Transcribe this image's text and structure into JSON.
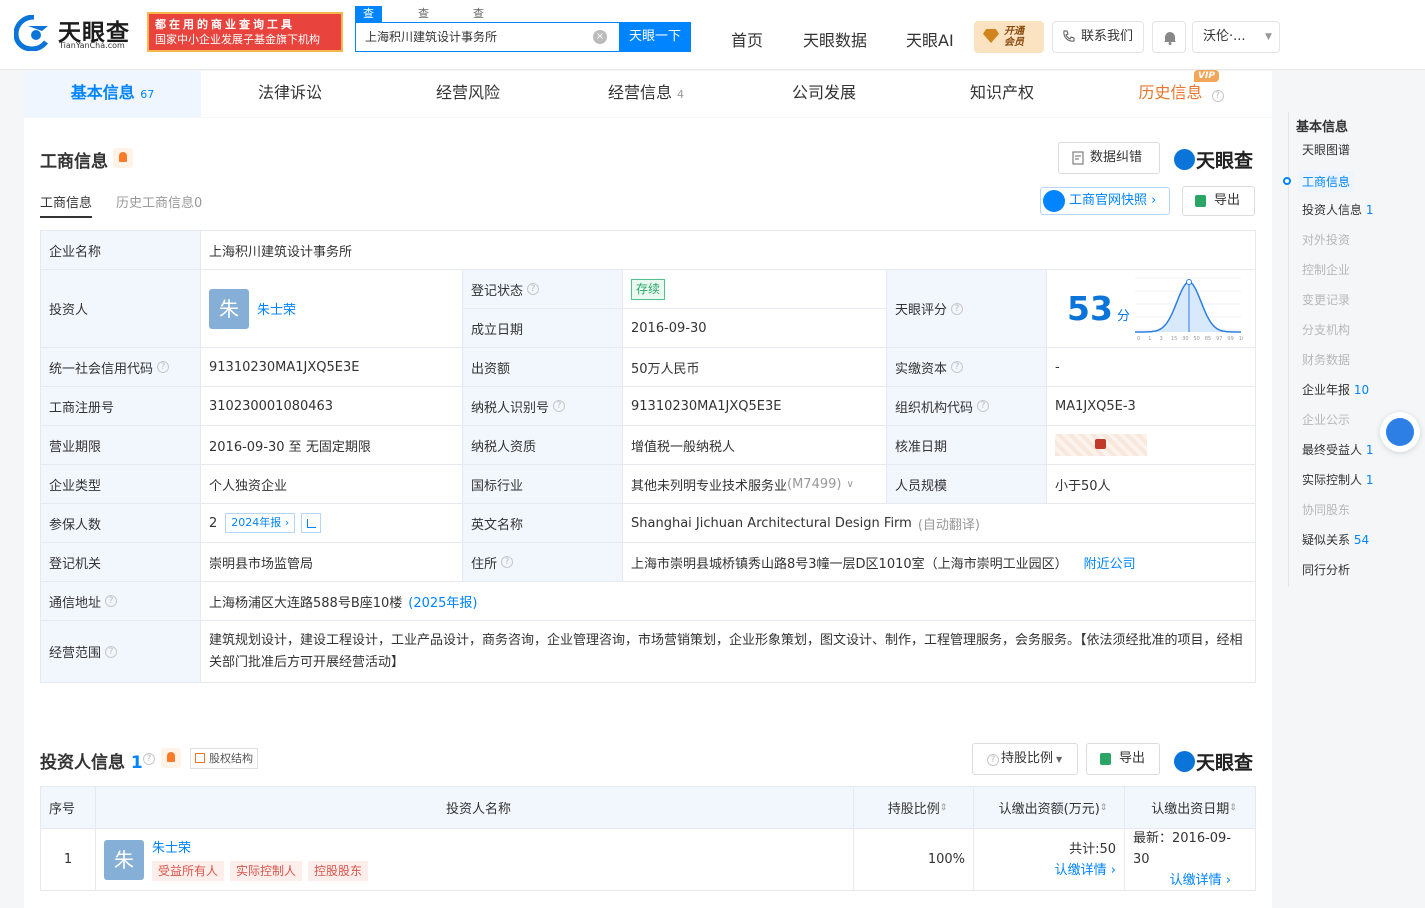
{
  "header": {
    "logo_cn": "天眼查",
    "logo_en": "TianYanCha.com",
    "promo_line1": "都在用的商业查询工具",
    "promo_line2": "国家中小企业发展子基金旗下机构",
    "search_tabs": [
      "查公司",
      "查老板",
      "查关系"
    ],
    "search_value": "上海积川建筑设计事务所",
    "search_button": "天眼一下",
    "nav": [
      "首页",
      "天眼数据",
      "天眼AI"
    ],
    "vip_line1": "开通",
    "vip_line2": "会员",
    "contact": "联系我们",
    "user": "沃伦·..."
  },
  "tabs": [
    {
      "label": "基本信息",
      "count": "67"
    },
    {
      "label": "法律诉讼",
      "count": ""
    },
    {
      "label": "经营风险",
      "count": ""
    },
    {
      "label": "经营信息",
      "count": "4"
    },
    {
      "label": "公司发展",
      "count": ""
    },
    {
      "label": "知识产权",
      "count": ""
    },
    {
      "label": "历史信息",
      "count": "",
      "vip": "VIP"
    }
  ],
  "biz": {
    "title": "工商信息",
    "correct_btn": "数据纠错",
    "brand": "天眼查",
    "sub_tabs": [
      "工商信息",
      "历史工商信息0"
    ],
    "snapshot_btn": "工商官网快照",
    "export_btn": "导出",
    "labels": {
      "name": "企业名称",
      "investor": "投资人",
      "reg_status": "登记状态",
      "found_date": "成立日期",
      "score": "天眼评分",
      "credit_code": "统一社会信用代码",
      "capital": "出资额",
      "paid_capital": "实缴资本",
      "reg_no": "工商注册号",
      "tax_id": "纳税人识别号",
      "org_code": "组织机构代码",
      "period": "营业期限",
      "tax_quality": "纳税人资质",
      "approve_date": "核准日期",
      "type": "企业类型",
      "industry": "国标行业",
      "staff": "人员规模",
      "insured": "参保人数",
      "en_name": "英文名称",
      "authority": "登记机关",
      "address": "住所",
      "mail_addr": "通信地址",
      "scope": "经营范围"
    },
    "values": {
      "name": "上海积川建筑设计事务所",
      "investor_avatar": "朱",
      "investor": "朱士荣",
      "reg_status": "存续",
      "found_date": "2016-09-30",
      "score": "53",
      "score_unit": "分",
      "credit_code": "91310230MA1JXQ5E3E",
      "capital": "50万人民币",
      "paid_capital": "-",
      "reg_no": "310230001080463",
      "tax_id": "91310230MA1JXQ5E3E",
      "org_code": "MA1JXQ5E-3",
      "period": "2016-09-30 至 无固定期限",
      "tax_quality": "增值税一般纳税人",
      "type": "个人独资企业",
      "industry": "其他未列明专业技术服务业",
      "industry_code": "(M7499)",
      "staff": "小于50人",
      "insured": "2",
      "insured_report": "2024年报",
      "en_name": "Shanghai Jichuan Architectural Design Firm",
      "en_note": "(自动翻译)",
      "authority": "崇明县市场监管局",
      "address": "上海市崇明县城桥镇秀山路8号3幢一层D区1010室（上海市崇明工业园区）",
      "nearby": "附近公司",
      "mail_addr": "上海杨浦区大连路588号B座10楼",
      "mail_note": "(2025年报)",
      "scope": "建筑规划设计，建设工程设计，工业产品设计，商务咨询，企业管理咨询，市场营销策划，企业形象策划，图文设计、制作，工程管理服务，会务服务。【依法须经批准的项目，经相关部门批准后方可开展经营活动】"
    },
    "score_ticks": [
      "0",
      "1",
      "3",
      "15",
      "30",
      "50",
      "85",
      "97",
      "99",
      "100"
    ]
  },
  "investors": {
    "title": "投资人信息",
    "count": "1",
    "equity_btn": "股权结构",
    "ratio_btn": "持股比例",
    "export_btn": "导出",
    "brand": "天眼查",
    "columns": [
      "序号",
      "投资人名称",
      "持股比例",
      "认缴出资额(万元)",
      "认缴出资日期"
    ],
    "rows": [
      {
        "no": "1",
        "avatar": "朱",
        "name": "朱士荣",
        "tags": [
          "受益所有人",
          "实际控制人",
          "控股股东"
        ],
        "ratio": "100%",
        "amount": "共计:50",
        "amount_link": "认缴详情",
        "date": "最新：2016-09-30",
        "date_link": "认缴详情"
      }
    ]
  },
  "right_nav": {
    "title": "基本信息",
    "items": [
      {
        "label": "天眼图谱",
        "count": "",
        "state": "normal"
      },
      {
        "label": "工商信息",
        "count": "",
        "state": "active"
      },
      {
        "label": "投资人信息",
        "count": "1",
        "state": "normal"
      },
      {
        "label": "对外投资",
        "count": "",
        "state": "disabled"
      },
      {
        "label": "控制企业",
        "count": "",
        "state": "disabled"
      },
      {
        "label": "变更记录",
        "count": "",
        "state": "disabled"
      },
      {
        "label": "分支机构",
        "count": "",
        "state": "disabled"
      },
      {
        "label": "财务数据",
        "count": "",
        "state": "disabled"
      },
      {
        "label": "企业年报",
        "count": "10",
        "state": "normal"
      },
      {
        "label": "企业公示",
        "count": "",
        "state": "disabled"
      },
      {
        "label": "最终受益人",
        "count": "1",
        "state": "normal"
      },
      {
        "label": "实际控制人",
        "count": "1",
        "state": "normal"
      },
      {
        "label": "协同股东",
        "count": "",
        "state": "disabled"
      },
      {
        "label": "疑似关系",
        "count": "54",
        "state": "normal"
      },
      {
        "label": "同行分析",
        "count": "",
        "state": "normal"
      }
    ]
  }
}
